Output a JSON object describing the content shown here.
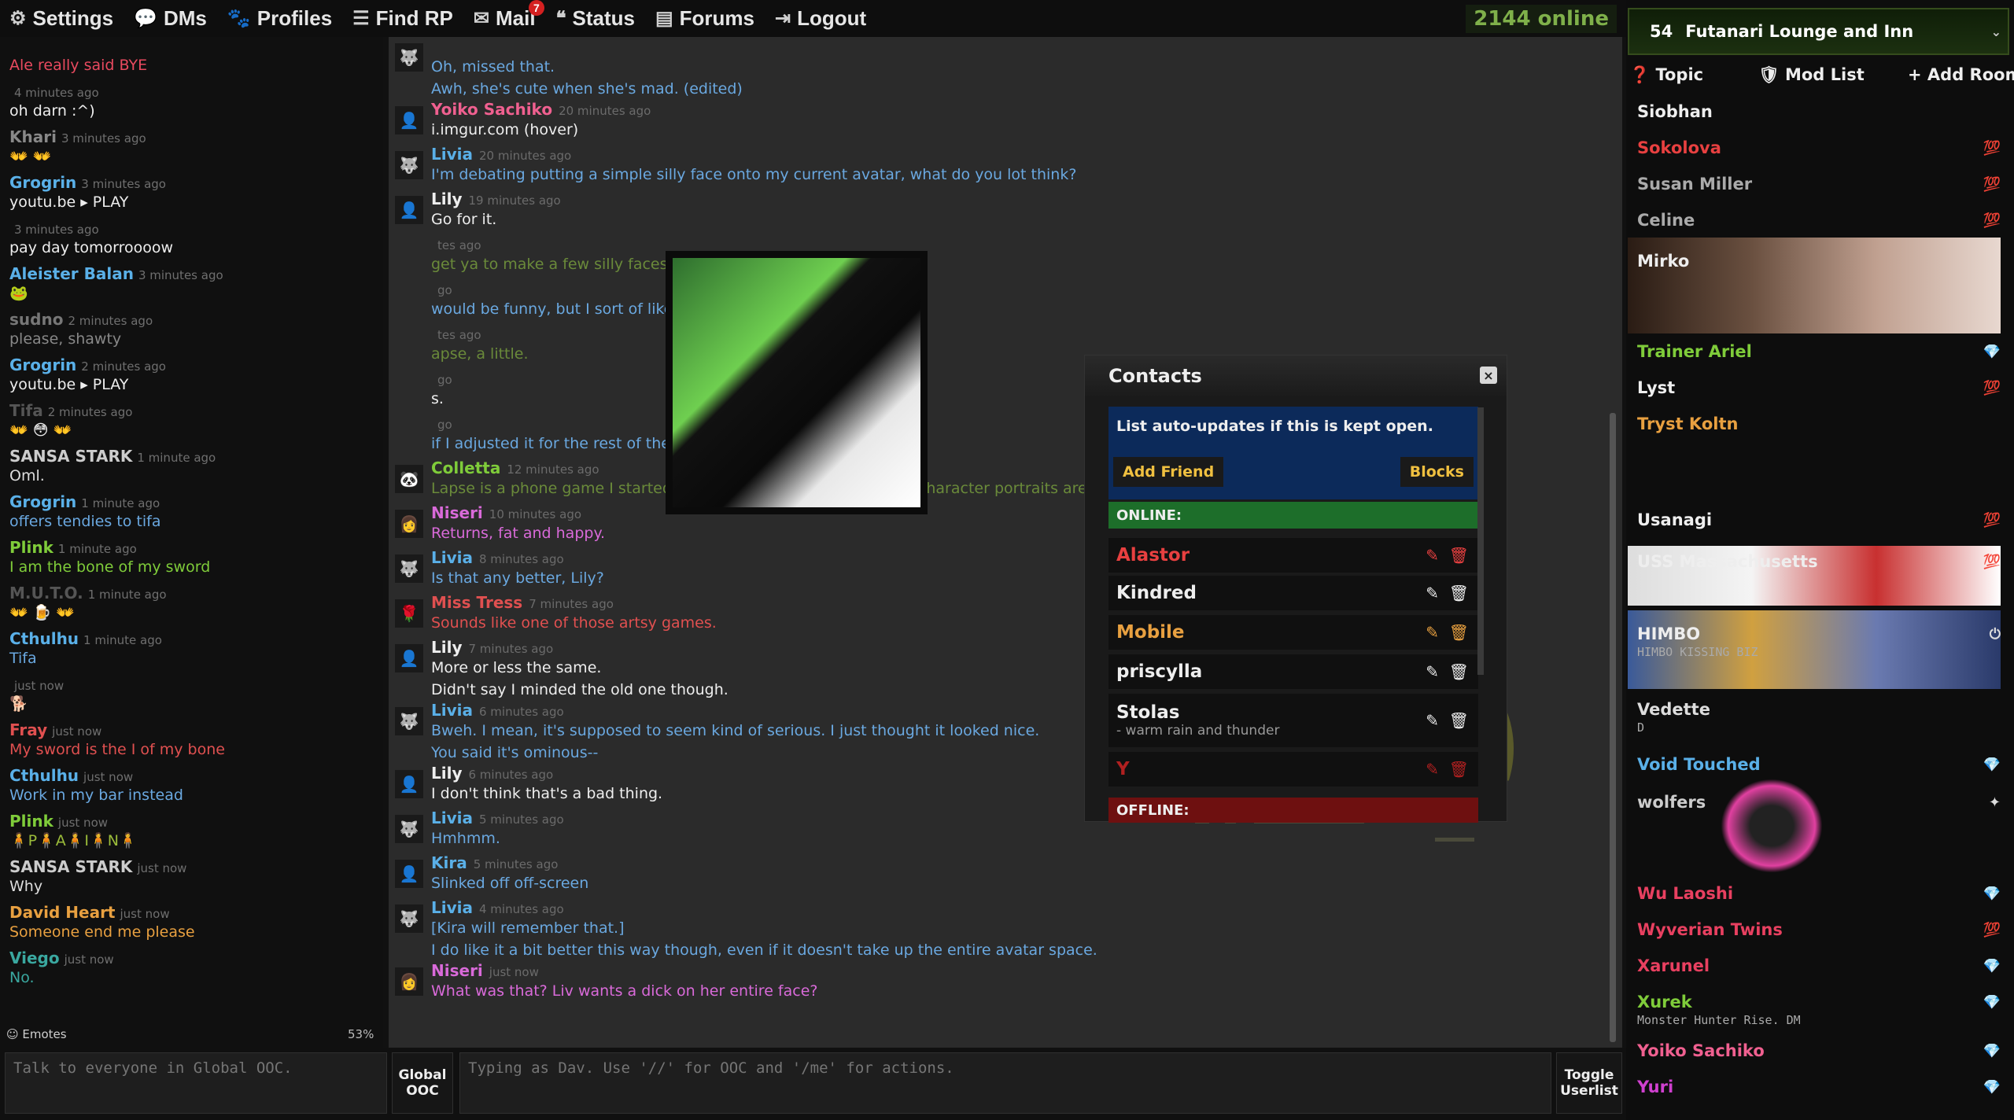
{
  "nav": {
    "settings": "Settings",
    "dms": "DMs",
    "profiles": "Profiles",
    "find_rp": "Find RP",
    "mail": "Mail",
    "mail_count": "7",
    "status": "Status",
    "forums": "Forums",
    "logout": "Logout",
    "online": "2144 online"
  },
  "left_chat": [
    {
      "name": "",
      "time": "",
      "text": "Ale really said BYE",
      "name_color": "#e84a5f",
      "text_color": "#e84a5f"
    },
    {
      "name": "",
      "time": "4 minutes ago",
      "text": "oh darn :^)",
      "name_color": "#aaa",
      "text_color": "#eeeeee"
    },
    {
      "name": "Khari",
      "time": "3 minutes ago",
      "text": "👐 👐",
      "name_color": "#888",
      "text_color": "#eee"
    },
    {
      "name": "Grogrin",
      "time": "3 minutes ago",
      "text": "youtu.be ▸ PLAY",
      "name_color": "#5ab0e8",
      "text_color": "#eee"
    },
    {
      "name": "",
      "time": "3 minutes ago",
      "text": "pay day tomorroooow",
      "name_color": "#aaa",
      "text_color": "#eee"
    },
    {
      "name": "Aleister Balan",
      "time": "3 minutes ago",
      "text": "🐸",
      "name_color": "#5ab0e8",
      "text_color": "#eee"
    },
    {
      "name": "sudno",
      "time": "2 minutes ago",
      "text": "please, shawty",
      "name_color": "#777",
      "text_color": "#888"
    },
    {
      "name": "Grogrin",
      "time": "2 minutes ago",
      "text": "youtu.be ▸ PLAY",
      "name_color": "#5ab0e8",
      "text_color": "#eee"
    },
    {
      "name": "Tifa",
      "time": "2 minutes ago",
      "text": "👐 😳 👐",
      "name_color": "#555",
      "text_color": "#eee"
    },
    {
      "name": "SANSA STARK",
      "time": "1 minute ago",
      "text": "Oml.",
      "name_color": "#cccccc",
      "text_color": "#ddd"
    },
    {
      "name": "Grogrin",
      "time": "1 minute ago",
      "text": "offers tendies to tifa",
      "name_color": "#5ab0e8",
      "text_color": "#6aa8e0"
    },
    {
      "name": "Plink",
      "time": "1 minute ago",
      "text": "I am the bone of my sword",
      "name_color": "#7fcc3a",
      "text_color": "#7fcc3a"
    },
    {
      "name": "M.U.T.O.",
      "time": "1 minute ago",
      "text": "👐 🍺 👐",
      "name_color": "#555",
      "text_color": "#eee"
    },
    {
      "name": "Cthulhu",
      "time": "1 minute ago",
      "text": "Tifa",
      "name_color": "#5ab0e8",
      "text_color": "#6aa8e0"
    },
    {
      "name": "",
      "time": "just now",
      "text": "🐕",
      "name_color": "#aaa",
      "text_color": "#eee"
    },
    {
      "name": "Fray",
      "time": "just now",
      "text": "My sword is the I of my bone",
      "name_color": "#e05050",
      "text_color": "#e05050"
    },
    {
      "name": "Cthulhu",
      "time": "just now",
      "text": "Work in my bar instead",
      "name_color": "#5ab0e8",
      "text_color": "#6aa8e0"
    },
    {
      "name": "Plink",
      "time": "just now",
      "text": "🧍P🧍A🧍I🧍N🧍",
      "name_color": "#7fcc3a",
      "text_color": "#9bbc3a"
    },
    {
      "name": "SANSA STARK",
      "time": "just now",
      "text": "Why",
      "name_color": "#cccccc",
      "text_color": "#ddd"
    },
    {
      "name": "David Heart",
      "time": "just now",
      "text": "Someone end me please",
      "name_color": "#e8a040",
      "text_color": "#e8a040"
    },
    {
      "name": "Viego",
      "time": "just now",
      "text": "No.",
      "name_color": "#3aa8a0",
      "text_color": "#3aa8a0"
    }
  ],
  "left_footer": {
    "emotes": "Emotes",
    "percent": "53%"
  },
  "center_chat": [
    {
      "name": "",
      "time": "",
      "text": "Oh, missed that.",
      "sub": "Awh, she's cute when she's mad. (edited)",
      "name_color": "#5ab0e8",
      "text_color": "#6aa8e0",
      "av": "🐺"
    },
    {
      "name": "Yoiko Sachiko",
      "time": "20 minutes ago",
      "text": "i.imgur.com (hover)",
      "sub": "",
      "name_color": "#f06090",
      "text_color": "#eee",
      "av": "👤"
    },
    {
      "name": "Livia",
      "time": "20 minutes ago",
      "text": "I'm debating putting a simple silly face onto my current avatar, what do you lot think?",
      "sub": "",
      "name_color": "#5ab0e8",
      "text_color": "#6aa8e0",
      "av": "🐺"
    },
    {
      "name": "Lily",
      "time": "19 minutes ago",
      "text": "Go for it.",
      "sub": "",
      "name_color": "#eee",
      "text_color": "#eee",
      "av": "👤"
    },
    {
      "name": "",
      "time": "tes ago",
      "text": "get ya to make a few silly faces...",
      "sub": "",
      "name_color": "#7fcc3a",
      "text_color": "#6a8a3a",
      "av": ""
    },
    {
      "name": "",
      "time": "go",
      "text": "would be funny, but I sort of like it for what it is now.",
      "sub": "",
      "name_color": "#5ab0e8",
      "text_color": "#6aa8e0",
      "av": ""
    },
    {
      "name": "",
      "time": "tes ago",
      "text": "apse, a little.",
      "sub": "",
      "name_color": "#7fcc3a",
      "text_color": "#6a8a3a",
      "av": ""
    },
    {
      "name": "",
      "time": "go",
      "text": "s.",
      "sub": "",
      "name_color": "#eee",
      "text_color": "#eee",
      "av": ""
    },
    {
      "name": "",
      "time": "go",
      "text": "if I adjusted it for the rest of the hair to be in it.",
      "sub": "",
      "name_color": "#5ab0e8",
      "text_color": "#6aa8e0",
      "av": ""
    },
    {
      "name": "Colletta",
      "time": "12 minutes ago",
      "text": "Lapse is a phone game I started playing some time ago... all the character portraits are blank",
      "sub": "",
      "name_color": "#7fcc3a",
      "text_color": "#6a8a3a",
      "av": "🐼"
    },
    {
      "name": "Niseri",
      "time": "10 minutes ago",
      "text": "Returns, fat and happy.",
      "sub": "",
      "name_color": "#d96ad9",
      "text_color": "#d96ad9",
      "av": "👩"
    },
    {
      "name": "Livia",
      "time": "8 minutes ago",
      "text": "Is that any better, Lily?",
      "sub": "",
      "name_color": "#5ab0e8",
      "text_color": "#6aa8e0",
      "av": "🐺"
    },
    {
      "name": "Miss Tress",
      "time": "7 minutes ago",
      "text": "Sounds like one of those artsy games.",
      "sub": "",
      "name_color": "#e05050",
      "text_color": "#e05050",
      "av": "🌹"
    },
    {
      "name": "Lily",
      "time": "7 minutes ago",
      "text": "More or less the same.",
      "sub": "Didn't say I minded the old one though.",
      "name_color": "#eee",
      "text_color": "#eee",
      "av": "👤"
    },
    {
      "name": "Livia",
      "time": "6 minutes ago",
      "text": "Bweh. I mean, it's supposed to seem kind of serious. I just thought it looked nice.",
      "sub": "You said it's ominous--",
      "name_color": "#5ab0e8",
      "text_color": "#6aa8e0",
      "av": "🐺"
    },
    {
      "name": "Lily",
      "time": "6 minutes ago",
      "text": "I don't think that's a bad thing.",
      "sub": "",
      "name_color": "#eee",
      "text_color": "#eee",
      "av": "👤"
    },
    {
      "name": "Livia",
      "time": "5 minutes ago",
      "text": "Hmhmm.",
      "sub": "",
      "name_color": "#5ab0e8",
      "text_color": "#6aa8e0",
      "av": "🐺"
    },
    {
      "name": "Kira",
      "time": "5 minutes ago",
      "text": "Slinked off off-screen",
      "sub": "",
      "name_color": "#5ab0e8",
      "text_color": "#6aa8e0",
      "av": "👤"
    },
    {
      "name": "Livia",
      "time": "4 minutes ago",
      "text": "[Kira will remember that.]",
      "sub": "I do like it a bit better this way though, even if it doesn't take up the entire avatar space.",
      "name_color": "#5ab0e8",
      "text_color": "#6aa8e0",
      "av": "🐺"
    },
    {
      "name": "Niseri",
      "time": "just now",
      "text": "What was that? Liv wants a dick on her entire face?",
      "sub": "",
      "name_color": "#d96ad9",
      "text_color": "#d96ad9",
      "av": "👩"
    }
  ],
  "contacts": {
    "title": "Contacts",
    "close": "×",
    "note": "List auto-updates if this is kept open.",
    "add_friend": "Add Friend",
    "blocks": "Blocks",
    "online_label": "ONLINE:",
    "offline_label": "OFFLINE:",
    "list": [
      {
        "name": "Alastor",
        "sub": "",
        "color": "#e84040",
        "edit_color": "#e84040",
        "del_color": "#e84040"
      },
      {
        "name": "Kindred",
        "sub": "",
        "color": "#eeeeee",
        "edit_color": "#eeeeee",
        "del_color": "#eeeeee"
      },
      {
        "name": "Mobile",
        "sub": "",
        "color": "#e8a040",
        "edit_color": "#e8a040",
        "del_color": "#e8a040"
      },
      {
        "name": "priscylla",
        "sub": "",
        "color": "#eeeeee",
        "edit_color": "#eeeeee",
        "del_color": "#eeeeee"
      },
      {
        "name": "Stolas",
        "sub": "- warm rain and thunder",
        "color": "#eeeeee",
        "edit_color": "#eeeeee",
        "del_color": "#eeeeee"
      },
      {
        "name": "Y",
        "sub": "",
        "color": "#b02020",
        "edit_color": "#b02020",
        "del_color": "#b02020"
      }
    ]
  },
  "room": {
    "count": "54",
    "name": "Futanari Lounge and Inn",
    "topic": "Topic",
    "mod_list": "Mod List",
    "add_room": "Add Room"
  },
  "users": [
    {
      "name": "Siobhan",
      "sub": "",
      "color": "#eeeeee",
      "icon": ""
    },
    {
      "name": "Sokolova",
      "sub": "",
      "color": "#e84040",
      "icon": "💯"
    },
    {
      "name": "Susan Miller",
      "sub": "",
      "color": "#aaaaaa",
      "icon": "💯"
    },
    {
      "name": "Celine",
      "sub": "",
      "color": "#aaaaaa",
      "icon": "💯"
    },
    {
      "name": "Mirko",
      "sub": "",
      "color": "#eeeeee",
      "icon": ""
    },
    {
      "name": "Trainer Ariel",
      "sub": "",
      "color": "#7fcc3a",
      "icon": "💎"
    },
    {
      "name": "Lyst",
      "sub": "",
      "color": "#eeeeee",
      "icon": "💯"
    },
    {
      "name": "Tryst Koltn",
      "sub": "",
      "color": "#e8a040",
      "icon": ""
    },
    {
      "name": "Usanagi",
      "sub": "",
      "color": "#eeeeee",
      "icon": "💯"
    },
    {
      "name": "USS Massachusetts",
      "sub": "",
      "color": "#eeeeee",
      "icon": "💯"
    },
    {
      "name": "HIMBO",
      "sub": "HIMBO KISSING BIZ",
      "color": "#eeeeee",
      "icon": "⏻"
    },
    {
      "name": "Vedette",
      "sub": "D",
      "color": "#dddddd",
      "icon": ""
    },
    {
      "name": "Void Touched",
      "sub": "",
      "color": "#5ab0e8",
      "icon": "💎"
    },
    {
      "name": "wolfers",
      "sub": "",
      "color": "#cccccc",
      "icon": "✦"
    },
    {
      "name": "Wu Laoshi",
      "sub": "",
      "color": "#e84060",
      "icon": "💎"
    },
    {
      "name": "Wyverian Twins",
      "sub": "",
      "color": "#e84060",
      "icon": "💯"
    },
    {
      "name": "Xarunel",
      "sub": "",
      "color": "#e84060",
      "icon": "💎"
    },
    {
      "name": "Xurek",
      "sub": "Monster Hunter Rise. DM",
      "color": "#7fcc3a",
      "icon": "💎"
    },
    {
      "name": "Yoiko Sachiko",
      "sub": "",
      "color": "#f06090",
      "icon": "💎"
    },
    {
      "name": "Yuri",
      "sub": "",
      "color": "#d040d0",
      "icon": "💎"
    }
  ],
  "input": {
    "left_placeholder": "Talk to everyone in Global OOC.",
    "global_ooc": "Global OOC",
    "main_placeholder": "Typing as Dav. Use '//' for OOC and '/me' for actions.",
    "toggle_userlist": "Toggle Userlist"
  }
}
